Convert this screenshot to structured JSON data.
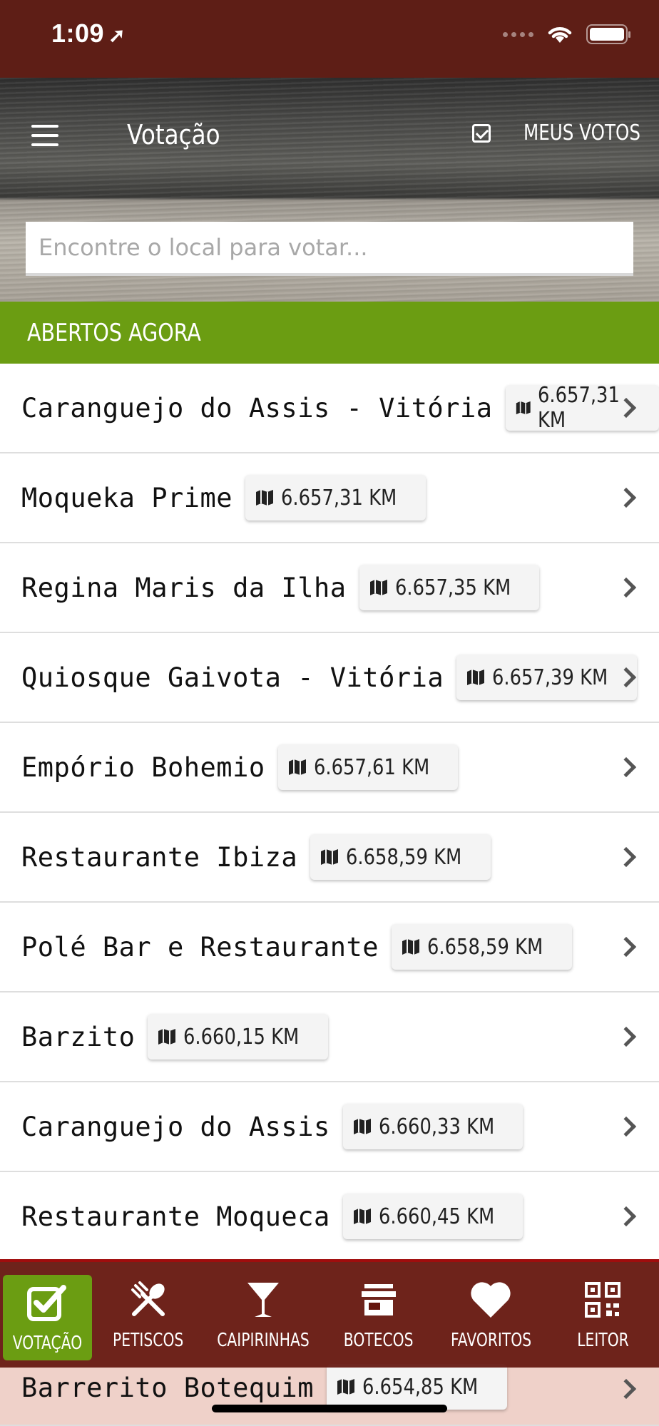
{
  "status_bar": {
    "time": "1:09",
    "location_arrow": "➚"
  },
  "header": {
    "menu_icon": "hamburger-icon",
    "title": "Votação",
    "my_votes_label": "MEUS VOTOS",
    "my_votes_icon": "checkbox-icon"
  },
  "search": {
    "placeholder": "Encontre o local para votar...",
    "value": ""
  },
  "section": {
    "title": "ABERTOS AGORA"
  },
  "venues": [
    {
      "name": "Caranguejo do Assis - Vitória",
      "distance": "6.657,31 KM"
    },
    {
      "name": "Moqueka Prime",
      "distance": "6.657,31 KM"
    },
    {
      "name": "Regina Maris da Ilha",
      "distance": "6.657,35 KM"
    },
    {
      "name": "Quiosque Gaivota - Vitória",
      "distance": "6.657,39 KM"
    },
    {
      "name": "Empório Bohemio",
      "distance": "6.657,61 KM"
    },
    {
      "name": "Restaurante Ibiza",
      "distance": "6.658,59 KM"
    },
    {
      "name": "Polé Bar e Restaurante",
      "distance": "6.658,59 KM"
    },
    {
      "name": "Barzito",
      "distance": "6.660,15 KM"
    },
    {
      "name": "Caranguejo do Assis",
      "distance": "6.660,33 KM"
    },
    {
      "name": "Restaurante Moqueca",
      "distance": "6.660,45 KM"
    },
    {
      "name": "Barrerito Botequim",
      "distance": "6.654,85 KM"
    }
  ],
  "tabs": [
    {
      "label": "VOTAÇÃO",
      "icon": "check-square-icon",
      "active": true
    },
    {
      "label": "PETISCOS",
      "icon": "fork-spoon-icon",
      "active": false
    },
    {
      "label": "CAIPIRINHAS",
      "icon": "cocktail-glass-icon",
      "active": false
    },
    {
      "label": "BOTECOS",
      "icon": "store-icon",
      "active": false
    },
    {
      "label": "FAVORITOS",
      "icon": "heart-icon",
      "active": false
    },
    {
      "label": "LEITOR",
      "icon": "qr-code-icon",
      "active": false
    }
  ],
  "colors": {
    "status_bar": "#5e1e16",
    "section_header": "#6b9d12",
    "tab_bar": "#64160e",
    "active_tab": "#6b9d12",
    "accent_line": "#a00d0d"
  }
}
